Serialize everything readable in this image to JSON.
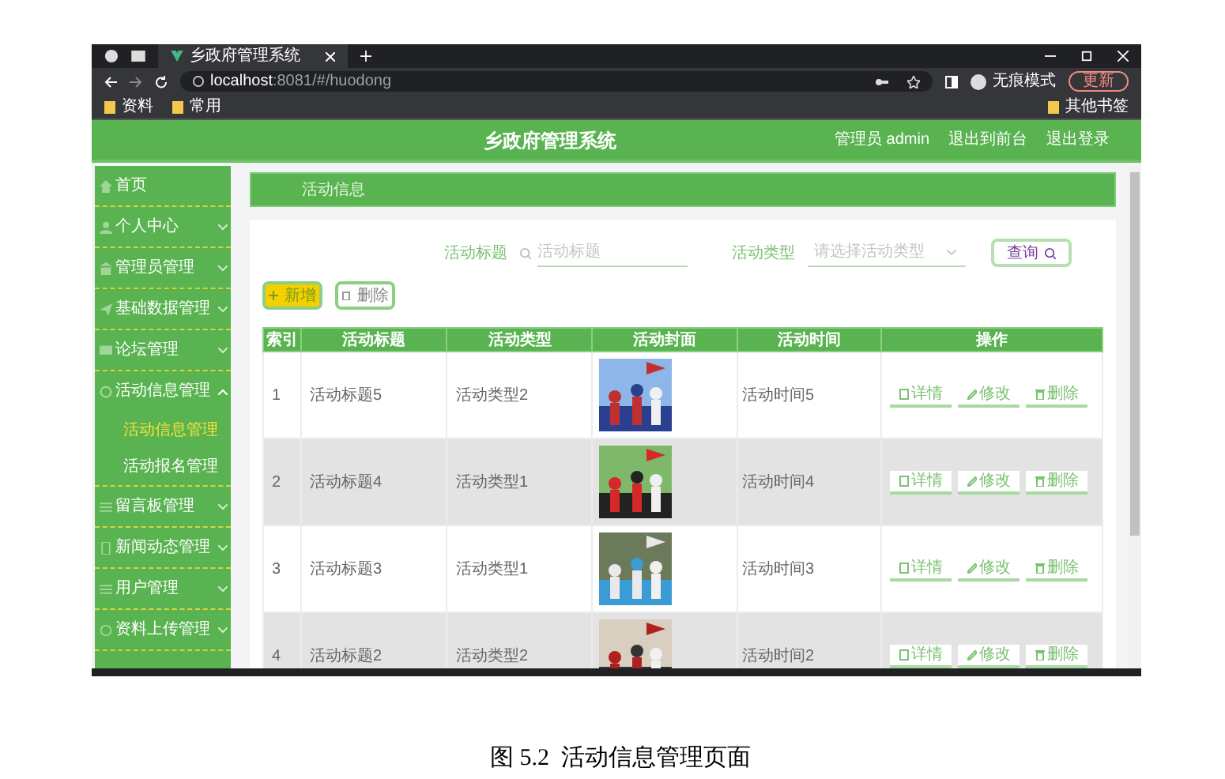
{
  "browser": {
    "tab_title": "乡政府管理系统",
    "url_host": "localhost",
    "url_path": ":8081/#/huodong",
    "incognito": "无痕模式",
    "update": "更新",
    "bookmarks": [
      "资料",
      "常用"
    ],
    "other_bookmarks": "其他书签"
  },
  "header": {
    "title": "乡政府管理系统",
    "links": [
      "管理员 admin",
      "退出到前台",
      "退出登录"
    ]
  },
  "sidebar": {
    "items": [
      {
        "label": "首页",
        "kind": "link"
      },
      {
        "label": "个人中心",
        "kind": "menu",
        "expanded": false
      },
      {
        "label": "管理员管理",
        "kind": "menu",
        "expanded": false
      },
      {
        "label": "基础数据管理",
        "kind": "menu",
        "expanded": false
      },
      {
        "label": "论坛管理",
        "kind": "menu",
        "expanded": false
      },
      {
        "label": "活动信息管理",
        "kind": "menu",
        "expanded": true,
        "children": [
          {
            "label": "活动信息管理",
            "selected": true
          },
          {
            "label": "活动报名管理",
            "selected": false
          }
        ]
      },
      {
        "label": "留言板管理",
        "kind": "menu",
        "expanded": false
      },
      {
        "label": "新闻动态管理",
        "kind": "menu",
        "expanded": false
      },
      {
        "label": "用户管理",
        "kind": "menu",
        "expanded": false
      },
      {
        "label": "资料上传管理",
        "kind": "menu",
        "expanded": false
      }
    ]
  },
  "breadcrumb": "活动信息",
  "search": {
    "title_label": "活动标题",
    "title_placeholder": "活动标题",
    "type_label": "活动类型",
    "type_placeholder": "请选择活动类型",
    "button": "查询"
  },
  "toolbar": [
    "新增",
    "删除"
  ],
  "table": {
    "columns": [
      "索引",
      "活动标题",
      "活动类型",
      "活动封面",
      "活动时间",
      "操作"
    ],
    "rows": [
      {
        "index": "1",
        "title": "活动标题5",
        "type": "活动类型2",
        "cover": {
          "kind": "picture"
        },
        "time": "活动时间5",
        "actions": [
          "详情",
          "修改",
          "删除"
        ]
      },
      {
        "index": "2",
        "title": "活动标题4",
        "type": "活动类型1",
        "cover": {
          "kind": "picture"
        },
        "time": "活动时间4",
        "actions": [
          "详情",
          "修改",
          "删除"
        ]
      },
      {
        "index": "3",
        "title": "活动标题3",
        "type": "活动类型1",
        "cover": {
          "kind": "picture"
        },
        "time": "活动时间3",
        "actions": [
          "详情",
          "修改",
          "删除"
        ]
      },
      {
        "index": "4",
        "title": "活动标题2",
        "type": "活动类型2",
        "cover": {
          "kind": "picture"
        },
        "time": "活动时间2",
        "actions": [
          "详情",
          "修改",
          "删除"
        ]
      }
    ]
  },
  "caption": "图 5.2  活动信息管理页面"
}
